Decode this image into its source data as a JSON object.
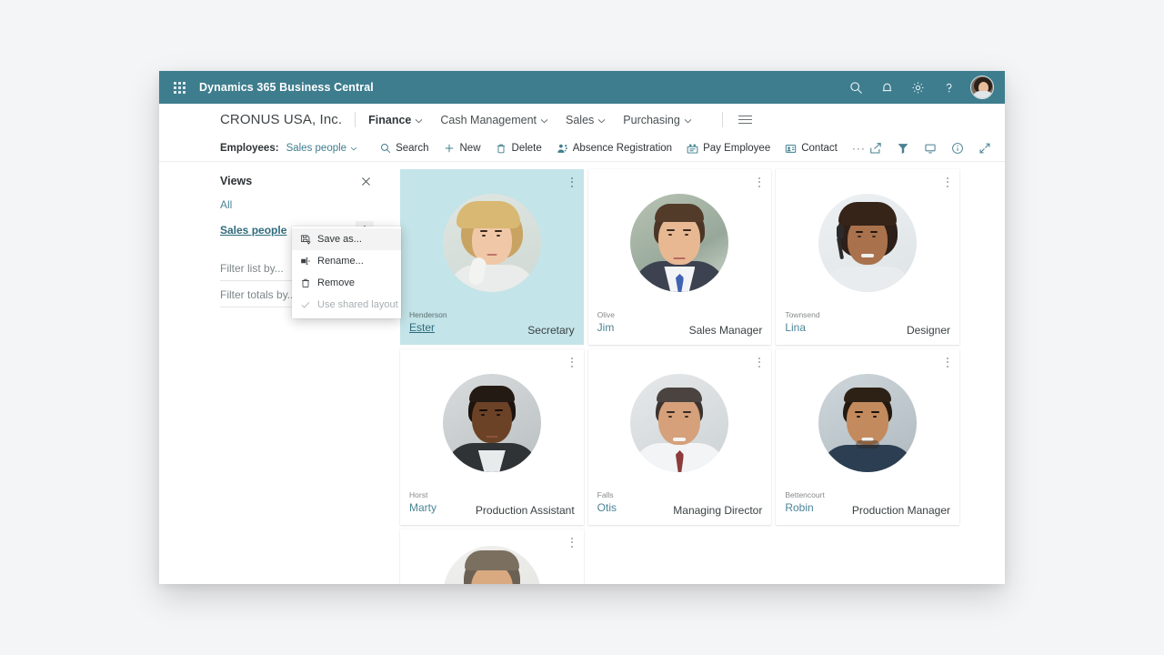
{
  "topbar": {
    "waffle_icon": "waffle-grid-icon",
    "app_title": "Dynamics 365 Business Central",
    "icons": [
      {
        "name": "search-icon",
        "label": "Search"
      },
      {
        "name": "notification-bell-icon",
        "label": "Notifications"
      },
      {
        "name": "gear-icon",
        "label": "Settings"
      },
      {
        "name": "help-question-icon",
        "label": "Help"
      }
    ],
    "avatar_name": "user-avatar"
  },
  "nav": {
    "company": "CRONUS USA, Inc.",
    "items": [
      {
        "label": "Finance",
        "active": true
      },
      {
        "label": "Cash Management",
        "active": false
      },
      {
        "label": "Sales",
        "active": false
      },
      {
        "label": "Purchasing",
        "active": false
      }
    ],
    "hamburger_icon": "hamburger-menu-icon"
  },
  "actionbar": {
    "entity_label": "Employees:",
    "view_selected": "Sales people",
    "actions": [
      {
        "label": "Search",
        "icon": "search-icon"
      },
      {
        "label": "New",
        "icon": "plus-icon"
      },
      {
        "label": "Delete",
        "icon": "trash-icon"
      },
      {
        "label": "Absence Registration",
        "icon": "absence-person-icon"
      },
      {
        "label": "Pay Employee",
        "icon": "pay-employee-icon"
      },
      {
        "label": "Contact",
        "icon": "contact-card-icon"
      }
    ],
    "overflow_label": "···",
    "right_icons": [
      {
        "name": "share-icon"
      },
      {
        "name": "filter-icon"
      },
      {
        "name": "focus-mode-icon"
      },
      {
        "name": "info-icon"
      },
      {
        "name": "expand-icon"
      },
      {
        "name": "bookmark-icon"
      }
    ]
  },
  "views": {
    "title": "Views",
    "close_icon": "close-icon",
    "items": [
      {
        "label": "All",
        "selected": false
      },
      {
        "label": "Sales people",
        "selected": true
      }
    ],
    "filters": [
      {
        "label": "Filter list by..."
      },
      {
        "label": "Filter totals by..."
      }
    ]
  },
  "context_menu": {
    "items": [
      {
        "label": "Save as...",
        "icon": "save-as-icon",
        "hover": true,
        "disabled": false
      },
      {
        "label": "Rename...",
        "icon": "rename-icon",
        "hover": false,
        "disabled": false
      },
      {
        "label": "Remove",
        "icon": "trash-icon",
        "hover": false,
        "disabled": false
      },
      {
        "label": "Use shared layout",
        "icon": "check-icon",
        "hover": false,
        "disabled": true
      }
    ]
  },
  "cards": [
    {
      "surname": "Henderson",
      "firstname": "Ester",
      "job_title": "Secretary",
      "selected": true
    },
    {
      "surname": "Olive",
      "firstname": "Jim",
      "job_title": "Sales Manager",
      "selected": false
    },
    {
      "surname": "Townsend",
      "firstname": "Lina",
      "job_title": "Designer",
      "selected": false
    },
    {
      "surname": "Horst",
      "firstname": "Marty",
      "job_title": "Production Assistant",
      "selected": false
    },
    {
      "surname": "Falls",
      "firstname": "Otis",
      "job_title": "Managing Director",
      "selected": false
    },
    {
      "surname": "Bettencourt",
      "firstname": "Robin",
      "job_title": "Production Manager",
      "selected": false
    }
  ],
  "colors": {
    "brand_teal": "#3e7d8e",
    "selected_card": "#c3e4e8",
    "link": "#4c8496",
    "page_bg": "#f4f5f7"
  }
}
